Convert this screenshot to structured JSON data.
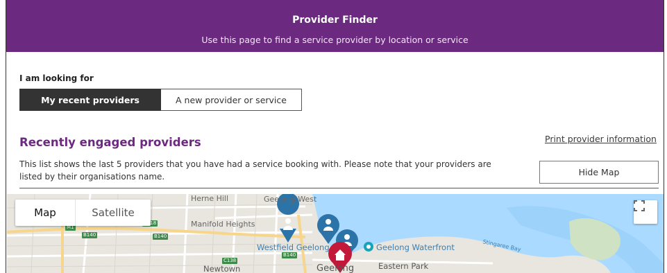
{
  "header": {
    "title": "Provider Finder",
    "subtitle": "Use this page to find a service provider by location or service"
  },
  "looking_for": {
    "label": "I am looking for",
    "options": [
      "My recent providers",
      "A new provider or service"
    ],
    "selected": "My recent providers"
  },
  "recent": {
    "title": "Recently engaged providers",
    "print_link": "Print provider information",
    "description": "This list shows the last 5 providers that you have had a service booking with. Please note that your providers are listed by their organisations name.",
    "hide_map_label": "Hide Map"
  },
  "map": {
    "type_options": [
      "Map",
      "Satellite"
    ],
    "selected_type": "Map",
    "place_labels": {
      "herne_hill": "Herne Hill",
      "geelong_west": "Geelong West",
      "manifold_heights": "Manifold Heights",
      "westfield": "Westfield Geelong",
      "waterfront": "Geelong Waterfront",
      "stingaree_bay": "Stingaree Bay",
      "newtown": "Newtown",
      "geelong": "Geelong",
      "eastern_park": "Eastern Park"
    },
    "road_badges": [
      "M1",
      "B140",
      "B140",
      "C118",
      "C138",
      "B140"
    ],
    "colors": {
      "water": "#aadaff",
      "land": "#e8e6df",
      "marker_provider": "#2c73a8",
      "marker_home": "#c2183a",
      "header_purple": "#6b2a7f"
    }
  }
}
